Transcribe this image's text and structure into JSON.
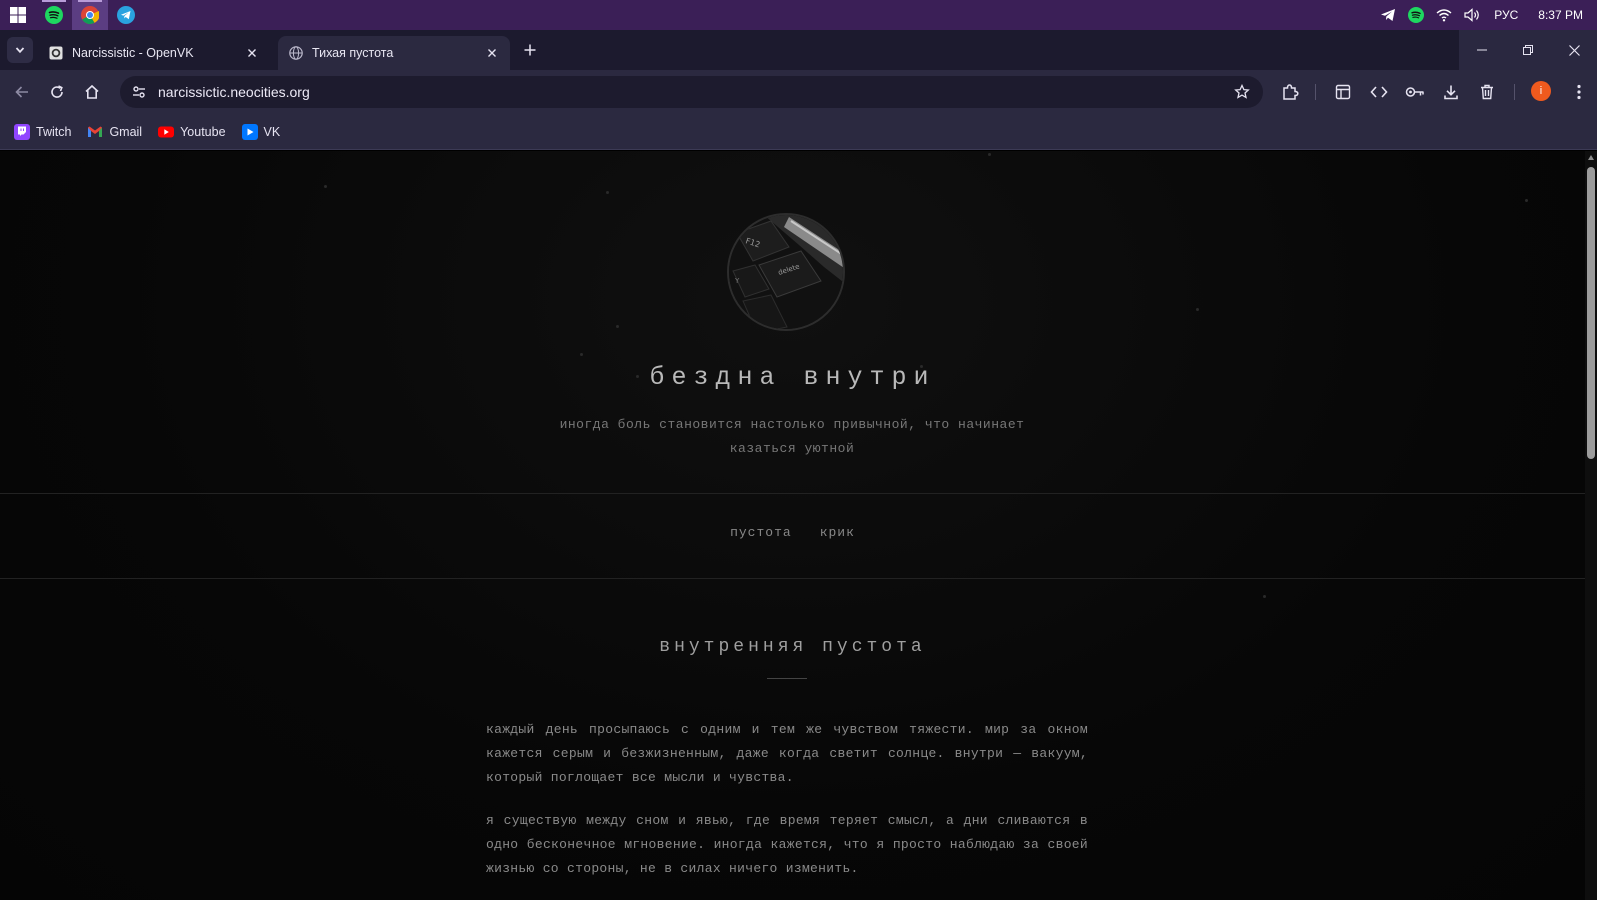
{
  "taskbar": {
    "apps": [
      {
        "name": "windows-start",
        "icon": "windows-logo-icon"
      },
      {
        "name": "spotify",
        "icon": "spotify-icon"
      },
      {
        "name": "chrome",
        "icon": "chrome-icon"
      },
      {
        "name": "telegram",
        "icon": "telegram-icon"
      }
    ],
    "tray": {
      "language": "РУС",
      "time": "8:37 PM"
    }
  },
  "browser": {
    "tabs": [
      {
        "title": "Narcissistic - OpenVK",
        "icon": "openvk-icon",
        "active": false
      },
      {
        "title": "Тихая пустота",
        "icon": "globe-icon",
        "active": true
      }
    ],
    "url": "narcissictic.neocities.org",
    "profile_initial": "i",
    "bookmarks": [
      {
        "label": "Twitch",
        "icon": "twitch-icon",
        "color": "#9146ff"
      },
      {
        "label": "Gmail",
        "icon": "gmail-icon",
        "color": "#ea4335"
      },
      {
        "label": "Youtube",
        "icon": "youtube-icon",
        "color": "#ff0000"
      },
      {
        "label": "VK",
        "icon": "vk-icon",
        "color": "#0077ff"
      }
    ]
  },
  "page": {
    "title": "бездна внутри",
    "subtitle": "иногда боль становится настолько привычной, что начинает казаться уютной",
    "nav": [
      "пустота",
      "крик"
    ],
    "section_title": "внутренняя пустота",
    "paragraphs": [
      "каждый день просыпаюсь с одним и тем же чувством тяжести. мир за окном кажется серым и безжизненным, даже когда светит солнце. внутри — вакуум, который поглощает все мысли и чувства.",
      "я существую между сном и явью, где время теряет смысл, а дни сливаются в одно бесконечное мгновение. иногда кажется, что я просто наблюдаю за своей жизнью со стороны, не в силах ничего изменить."
    ]
  }
}
